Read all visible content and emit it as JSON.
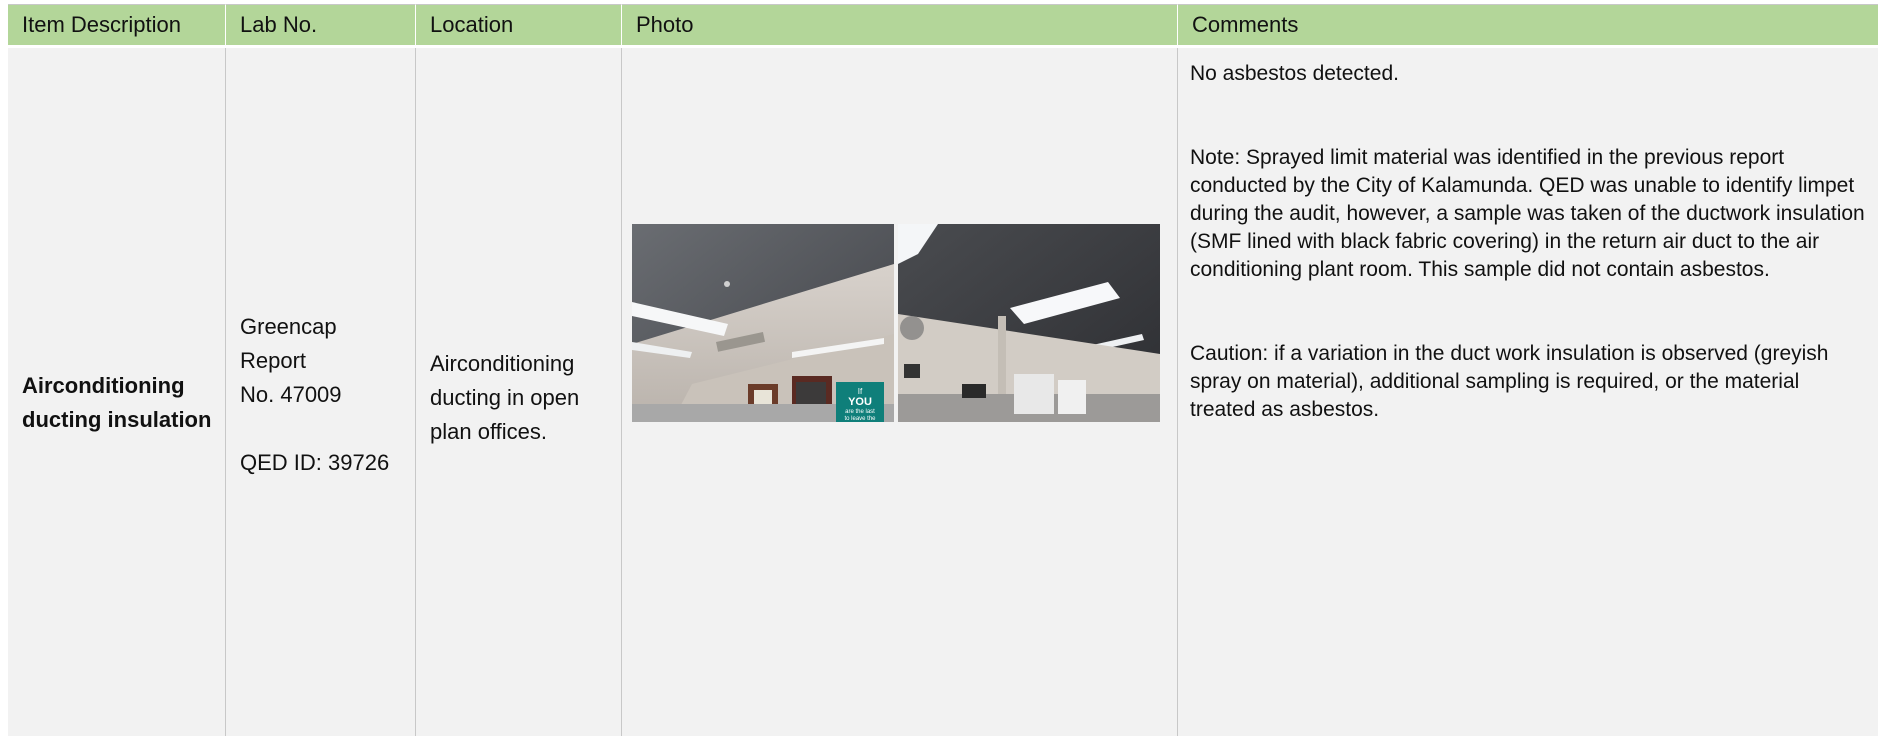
{
  "headers": {
    "item": "Item Description",
    "lab": "Lab No.",
    "location": "Location",
    "photo": "Photo",
    "comments": "Comments"
  },
  "row": {
    "item_line1": "Airconditioning",
    "item_line2": "ducting insulation",
    "lab_line1": "Greencap Report",
    "lab_line2": "No. 47009",
    "lab_line3": "QED ID: 39726",
    "location_line1": "Airconditioning",
    "location_line2": "ducting in open",
    "location_line3": "plan offices.",
    "comments": [
      "No asbestos detected.",
      "Note: Sprayed limit material was identified in the previous report conducted by the City of Kalamunda. QED was unable to identify limpet during the audit, however, a sample was taken of the ductwork insulation (SMF lined with black fabric covering) in the return air duct to the air conditioning plant room. This sample did not contain asbestos.",
      "Caution: if a variation in the duct work insulation is observed (greyish spray on material), additional sampling is required, or the material treated as asbestos."
    ],
    "photo_sign_text": [
      "If",
      "YOU",
      "are the last",
      "to leave the"
    ]
  },
  "colors": {
    "header_bg": "#b3d699",
    "cell_bg": "#f2f2f2",
    "border": "#c8c8c8"
  }
}
